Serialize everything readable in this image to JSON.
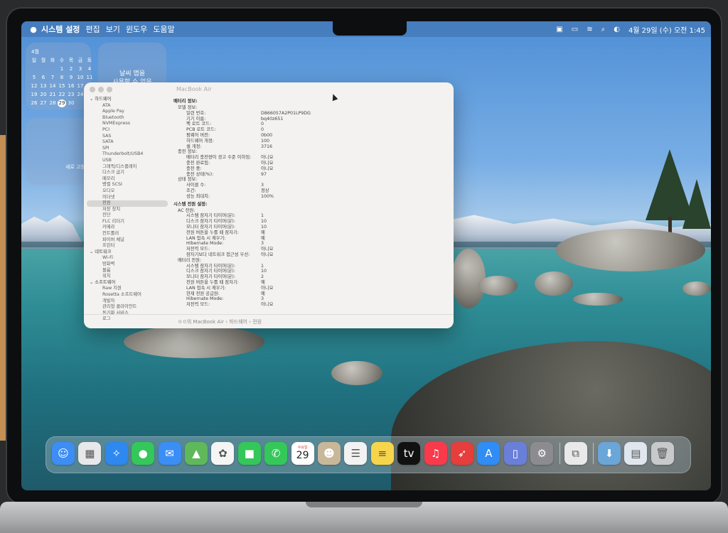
{
  "menubar": {
    "apple": "",
    "app": "시스템 설정",
    "items": [
      "편집",
      "보기",
      "윈도우",
      "도움말"
    ],
    "clock": "4월 29일 (수) 오전 1:45"
  },
  "widgets": {
    "calendar_month": "4월",
    "calendar_days": [
      "일",
      "월",
      "화",
      "수",
      "목",
      "금",
      "토",
      "",
      "",
      "",
      "1",
      "2",
      "3",
      "4",
      "5",
      "6",
      "7",
      "8",
      "9",
      "10",
      "11",
      "12",
      "13",
      "14",
      "15",
      "16",
      "17",
      "18",
      "19",
      "20",
      "21",
      "22",
      "23",
      "24",
      "25",
      "26",
      "27",
      "28",
      "29",
      "30",
      "",
      ""
    ],
    "calendar_today": "29",
    "weather_line1": "날씨 앱을",
    "weather_line2": "사용할 수 없음",
    "w3_text": "새로 고침"
  },
  "window": {
    "title": "MacBook Air",
    "sidebar": [
      {
        "t": "sec",
        "label": "하드웨어"
      },
      {
        "t": "it",
        "label": "ATA"
      },
      {
        "t": "it",
        "label": "Apple Pay"
      },
      {
        "t": "it",
        "label": "Bluetooth"
      },
      {
        "t": "it",
        "label": "NVMExpress"
      },
      {
        "t": "it",
        "label": "PCI"
      },
      {
        "t": "it",
        "label": "SAS"
      },
      {
        "t": "it",
        "label": "SATA"
      },
      {
        "t": "it",
        "label": "SPI"
      },
      {
        "t": "it",
        "label": "Thunderbolt/USB4"
      },
      {
        "t": "it",
        "label": "USB"
      },
      {
        "t": "it",
        "label": "그래픽/디스플레이"
      },
      {
        "t": "it",
        "label": "디스크 굽기"
      },
      {
        "t": "it",
        "label": "메모리"
      },
      {
        "t": "it",
        "label": "병렬 SCSI"
      },
      {
        "t": "it",
        "label": "오디오"
      },
      {
        "t": "it",
        "label": "이더넷"
      },
      {
        "t": "it",
        "label": "전원",
        "sel": true
      },
      {
        "t": "it",
        "label": "저장 장치"
      },
      {
        "t": "it",
        "label": "진단"
      },
      {
        "t": "it",
        "label": "FLC 리더기"
      },
      {
        "t": "it",
        "label": "카메라"
      },
      {
        "t": "it",
        "label": "컨트롤러"
      },
      {
        "t": "it",
        "label": "파이버 채널"
      },
      {
        "t": "it",
        "label": "프린터"
      },
      {
        "t": "sec",
        "label": "네트워크"
      },
      {
        "t": "it",
        "label": "Wi-Fi"
      },
      {
        "t": "it",
        "label": "방화벽"
      },
      {
        "t": "it",
        "label": "볼륨"
      },
      {
        "t": "it",
        "label": "위치"
      },
      {
        "t": "sec",
        "label": "소프트웨어"
      },
      {
        "t": "it",
        "label": "Raw 지원"
      },
      {
        "t": "it",
        "label": "Rosetta 소프트웨어"
      },
      {
        "t": "it",
        "label": "개발자"
      },
      {
        "t": "it",
        "label": "관리형 클라이언트"
      },
      {
        "t": "it",
        "label": "동기화 서비스"
      },
      {
        "t": "it",
        "label": "로그"
      }
    ],
    "content": [
      {
        "h": "배터리 정보:"
      },
      {
        "k": "모델 정보:",
        "v": "",
        "i": 0
      },
      {
        "k": "일련 번호:",
        "v": "D866057A2P01LP9DG",
        "i": 1
      },
      {
        "k": "기기 이름:",
        "v": "bq40z651",
        "i": 1
      },
      {
        "k": "팩 로트 코드:",
        "v": "0",
        "i": 1
      },
      {
        "k": "PCB 로트 코드:",
        "v": "0",
        "i": 1
      },
      {
        "k": "펌웨어 버전:",
        "v": "0b00",
        "i": 1
      },
      {
        "k": "하드웨어 개정:",
        "v": "100",
        "i": 1
      },
      {
        "k": "셀 개정:",
        "v": "3716",
        "i": 1
      },
      {
        "k": "충전 정보:",
        "v": "",
        "i": 0
      },
      {
        "k": "배터리 충전량이 경고 수준 이하임:",
        "v": "아니요",
        "i": 1
      },
      {
        "k": "충전 완료됨:",
        "v": "아니요",
        "i": 1
      },
      {
        "k": "충전 중:",
        "v": "아니요",
        "i": 1
      },
      {
        "k": "충전 상태(%):",
        "v": "97",
        "i": 1
      },
      {
        "k": "상태 정보:",
        "v": "",
        "i": 0
      },
      {
        "k": "사이클 수:",
        "v": "3",
        "i": 1
      },
      {
        "k": "조건:",
        "v": "정상",
        "i": 1
      },
      {
        "k": "성능 최대치:",
        "v": "100%",
        "i": 1
      },
      {
        "h": "시스템 전원 설정:"
      },
      {
        "k": "AC 전원:",
        "v": "",
        "i": 0
      },
      {
        "k": "시스템 잠자기 타이머(분):",
        "v": "1",
        "i": 1
      },
      {
        "k": "디스크 잠자기 타이머(분):",
        "v": "10",
        "i": 1
      },
      {
        "k": "모니터 잠자기 타이머(분):",
        "v": "10",
        "i": 1
      },
      {
        "k": "전원 버튼을 누를 때 잠자기:",
        "v": "예",
        "i": 1
      },
      {
        "k": "LAN 접속 시 깨우기:",
        "v": "예",
        "i": 1
      },
      {
        "k": "Hibernate Mode:",
        "v": "3",
        "i": 1
      },
      {
        "k": "저전력 모드:",
        "v": "아니요",
        "i": 1
      },
      {
        "k": "잠자기보다 네트워크 접근성 우선:",
        "v": "아니요",
        "i": 1
      },
      {
        "k": "배터리 전원:",
        "v": "",
        "i": 0
      },
      {
        "k": "시스템 잠자기 타이머(분):",
        "v": "1",
        "i": 1
      },
      {
        "k": "디스크 잠자기 타이머(분):",
        "v": "10",
        "i": 1
      },
      {
        "k": "모니터 잠자기 타이머(분):",
        "v": "2",
        "i": 1
      },
      {
        "k": "전원 버튼을 누를 때 잠자기:",
        "v": "예",
        "i": 1
      },
      {
        "k": "LAN 접속 시 깨우기:",
        "v": "아니요",
        "i": 1
      },
      {
        "k": "현재 전원 공급원:",
        "v": "예",
        "i": 1
      },
      {
        "k": "Hibernate Mode:",
        "v": "3",
        "i": 1
      },
      {
        "k": "저전력 모드:",
        "v": "아니요",
        "i": 1
      }
    ],
    "path": "ㅇㅇ의 MacBook Air › 하드웨어 › 전원"
  },
  "dock": [
    {
      "name": "finder-icon",
      "glyph": "☺",
      "color": "#3d8df5"
    },
    {
      "name": "launchpad-icon",
      "glyph": "▦",
      "color": "#e8e8ea"
    },
    {
      "name": "safari-icon",
      "glyph": "✧",
      "color": "#2d88f0"
    },
    {
      "name": "messages-icon",
      "glyph": "●",
      "color": "#34c759"
    },
    {
      "name": "mail-icon",
      "glyph": "✉",
      "color": "#3a8ef5"
    },
    {
      "name": "maps-icon",
      "glyph": "▲",
      "color": "#5fb85a"
    },
    {
      "name": "photos-icon",
      "glyph": "✿",
      "color": "#f5f5f5"
    },
    {
      "name": "facetime-icon",
      "glyph": "■",
      "color": "#34c759"
    },
    {
      "name": "phone-icon",
      "glyph": "✆",
      "color": "#34c759"
    },
    {
      "name": "calendar-icon",
      "glyph": "29",
      "color": "#ffffff",
      "top": "수요일"
    },
    {
      "name": "contacts-icon",
      "glyph": "☻",
      "color": "#c9b79a"
    },
    {
      "name": "reminders-icon",
      "glyph": "☰",
      "color": "#f2f2f2"
    },
    {
      "name": "notes-icon",
      "glyph": "≡",
      "color": "#f7d54a"
    },
    {
      "name": "appletv-icon",
      "glyph": "tv",
      "color": "#111111"
    },
    {
      "name": "music-icon",
      "glyph": "♫",
      "color": "#fa3a4a"
    },
    {
      "name": "rocket-icon",
      "glyph": "➶",
      "color": "#e63d3d"
    },
    {
      "name": "appstore-icon",
      "glyph": "A",
      "color": "#2f8df5"
    },
    {
      "name": "iphone-mirroring-icon",
      "glyph": "▯",
      "color": "#6a7fd9"
    },
    {
      "name": "system-settings-icon",
      "glyph": "⚙",
      "color": "#8c8c90"
    },
    {
      "name": "sep",
      "glyph": "",
      "color": ""
    },
    {
      "name": "preview-icon",
      "glyph": "⧉",
      "color": "#e9e9ea"
    },
    {
      "name": "sep",
      "glyph": "",
      "color": ""
    },
    {
      "name": "downloads-folder-icon",
      "glyph": "⬇",
      "color": "#6aa6d8"
    },
    {
      "name": "documents-stack-icon",
      "glyph": "▤",
      "color": "#dfe6ee"
    },
    {
      "name": "trash-icon",
      "glyph": "🗑",
      "color": "#c8c9cb"
    }
  ]
}
